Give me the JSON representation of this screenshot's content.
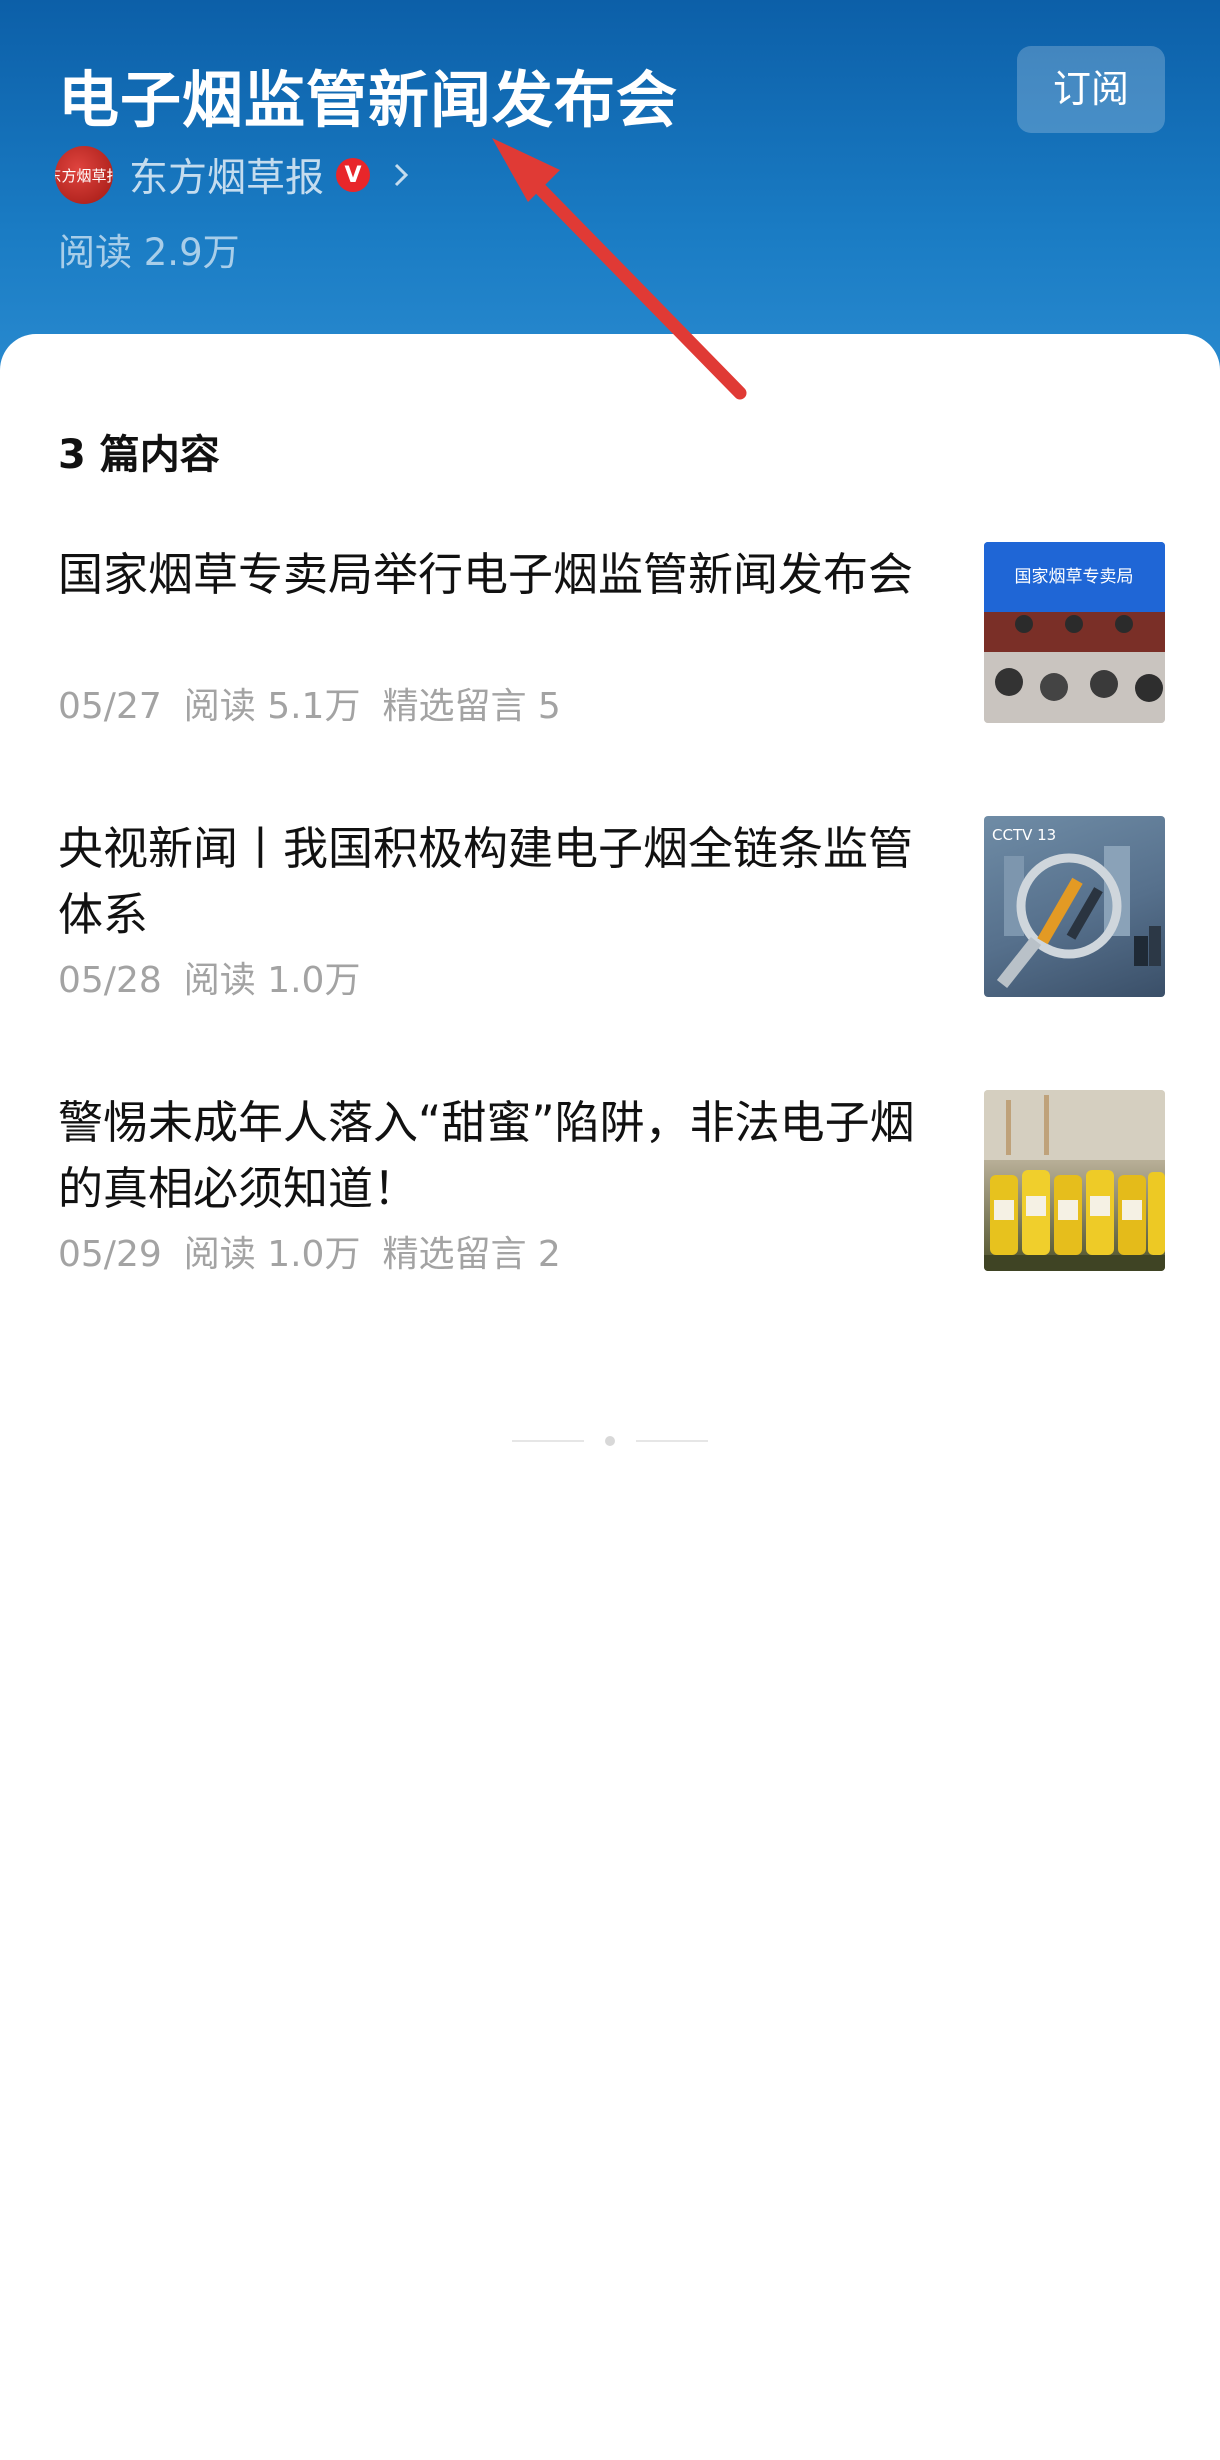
{
  "header": {
    "title": "电子烟监管新闻发布会",
    "subscribe_label": "订阅",
    "author": {
      "logo_text": "东方烟草报",
      "name": "东方烟草报",
      "verified_badge": "V"
    },
    "reads": "阅读 2.9万"
  },
  "content": {
    "count_label": "3 篇内容",
    "articles": [
      {
        "title": "国家烟草专卖局举行电子烟监管新闻发布会",
        "date": "05/27",
        "reads": "阅读 5.1万",
        "comments": "精选留言 5"
      },
      {
        "title": "央视新闻丨我国积极构建电子烟全链条监管体系",
        "date": "05/28",
        "reads": "阅读 1.0万",
        "comments": ""
      },
      {
        "title": "警惕未成年人落入“甜蜜”陷阱，非法电子烟的真相必须知道！",
        "date": "05/29",
        "reads": "阅读 1.0万",
        "comments": "精选留言 2"
      }
    ]
  },
  "thumbs": {
    "t1_text": "国家烟草专卖局",
    "t2_text": "CCTV 13"
  },
  "colors": {
    "header_blue": "#1a7cc4",
    "arrow_red": "#e03a35",
    "verified_red": "#e8262a"
  }
}
